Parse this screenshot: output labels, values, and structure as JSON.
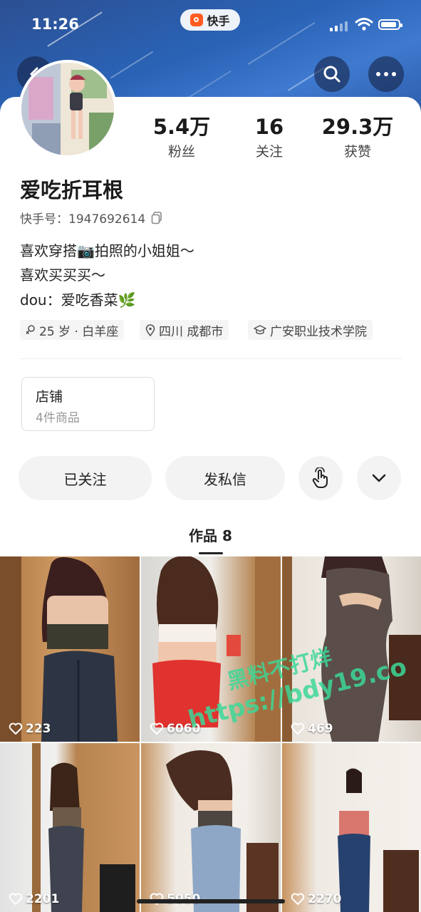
{
  "status_bar": {
    "time": "11:26",
    "app_name": "快手"
  },
  "profile": {
    "name": "爱吃折耳根",
    "kuaishou_id_label": "快手号：",
    "kuaishou_id": "1947692614",
    "bio_lines": [
      "喜欢穿搭📷拍照的小姐姐～",
      "喜欢买买买～",
      "dou：爱吃香菜🌿"
    ],
    "tags": [
      "25 岁 · 白羊座",
      "四川 成都市",
      "广安职业技术学院"
    ]
  },
  "stats": [
    {
      "value": "5.4万",
      "label": "粉丝"
    },
    {
      "value": "16",
      "label": "关注"
    },
    {
      "value": "29.3万",
      "label": "获赞"
    }
  ],
  "shop": {
    "title": "店铺",
    "subtitle": "4件商品"
  },
  "actions": {
    "follow_label": "已关注",
    "message_label": "发私信"
  },
  "works_tab": {
    "label": "作品 8"
  },
  "videos": [
    {
      "likes": "223"
    },
    {
      "likes": "6060"
    },
    {
      "likes": "469"
    },
    {
      "likes": "2201"
    },
    {
      "likes": "5050"
    },
    {
      "likes": "2270"
    }
  ],
  "watermark": {
    "line1": "黑料不打烊",
    "line2": "https://bdy19.co"
  },
  "icons": [
    "back-icon",
    "search-icon",
    "more-icon",
    "copy-icon",
    "gender-female-icon",
    "location-pin-icon",
    "school-icon",
    "touch-hand-icon",
    "chevron-down-icon",
    "heart-icon"
  ]
}
